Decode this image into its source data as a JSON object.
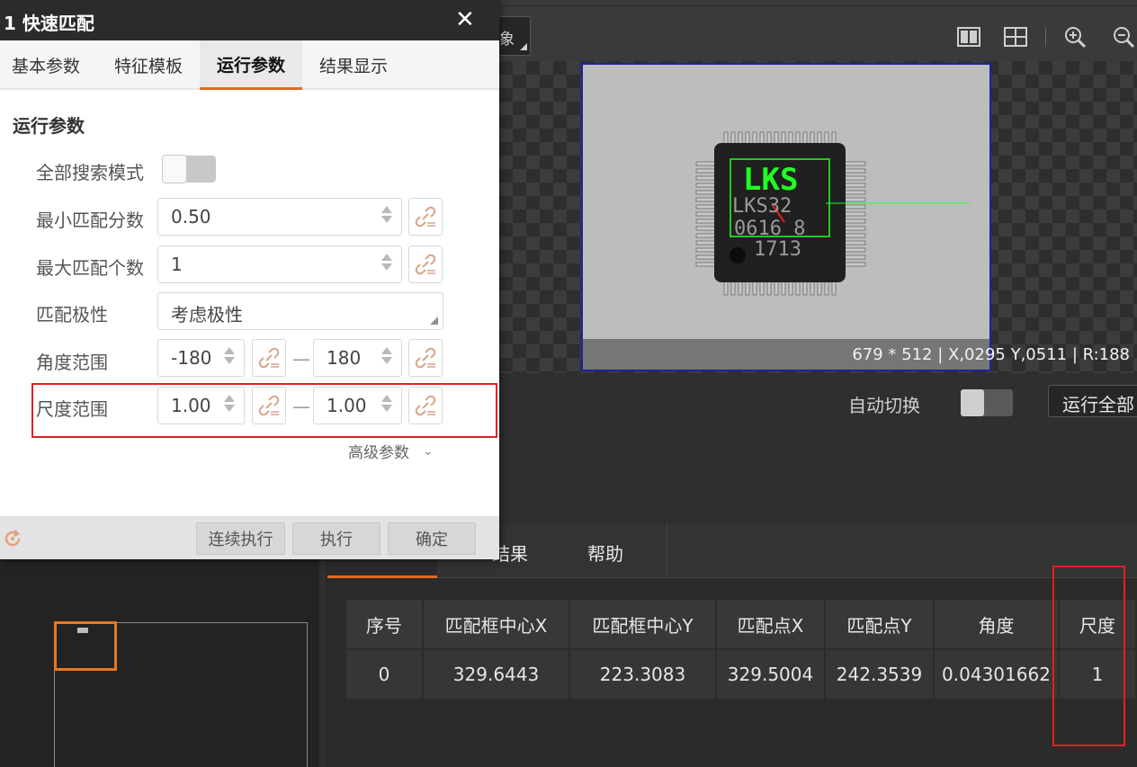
{
  "dialog": {
    "title": "1 快速匹配",
    "tabs": [
      "基本参数",
      "特征模板",
      "运行参数",
      "结果显示"
    ],
    "active_tab": "运行参数",
    "section_title": "运行参数",
    "params": {
      "full_search_label": "全部搜索模式",
      "full_search_on": false,
      "min_score_label": "最小匹配分数",
      "min_score_value": "0.50",
      "max_count_label": "最大匹配个数",
      "max_count_value": "1",
      "polarity_label": "匹配极性",
      "polarity_value": "考虑极性",
      "angle_label": "角度范围",
      "angle_min": "-180",
      "angle_max": "180",
      "scale_label": "尺度范围",
      "scale_min": "1.00",
      "scale_max": "1.00",
      "range_dash": "—"
    },
    "advanced_label": "高级参数",
    "buttons": {
      "continuous": "连续执行",
      "execute": "执行",
      "confirm": "确定"
    }
  },
  "toolbar": {
    "dropdown_tail": "象"
  },
  "viewer": {
    "status_text": "679 * 512  |  X,0295  Y,0511  |  R:188",
    "chip_text": [
      "LKS",
      "LKS32",
      "0616 8",
      "1713"
    ],
    "auto_switch_label": "自动切换",
    "auto_switch_on": false,
    "run_all_label": "运行全部"
  },
  "results": {
    "tabs": [
      "结果",
      "帮助"
    ],
    "columns": [
      "序号",
      "匹配框中心X",
      "匹配框中心Y",
      "匹配点X",
      "匹配点Y",
      "角度",
      "尺度"
    ],
    "rows": [
      [
        "0",
        "329.6443",
        "223.3083",
        "329.5004",
        "242.3539",
        "0.04301662",
        "1"
      ]
    ]
  },
  "colors": {
    "accent": "#e06a1f",
    "highlight": "#e02020",
    "match": "#22ff22"
  }
}
